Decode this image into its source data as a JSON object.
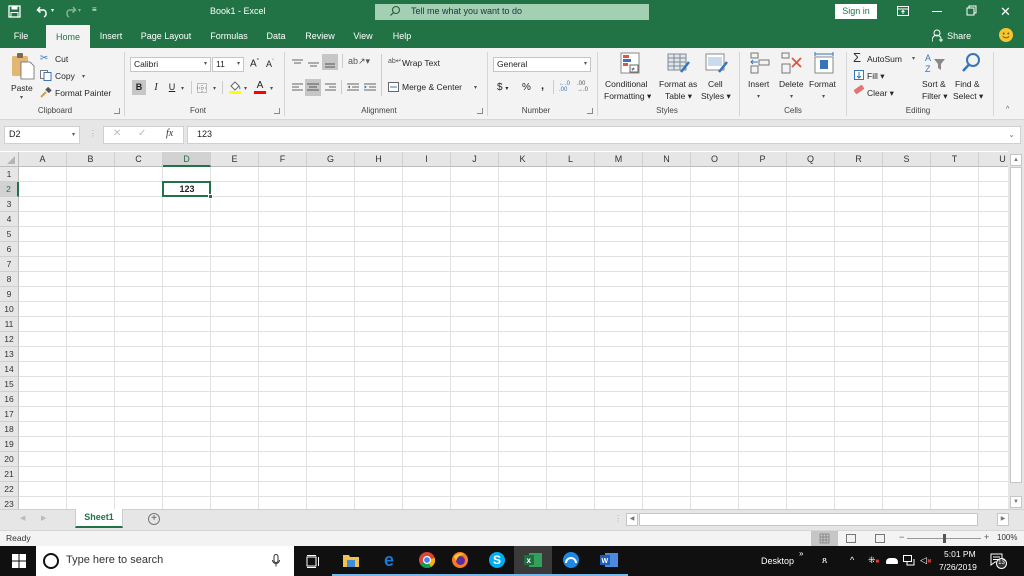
{
  "window": {
    "title": "Book1  -  Excel",
    "tell_me_placeholder": "Tell me what you want to do",
    "sign_in": "Sign in",
    "share": "Share"
  },
  "quick_access": {
    "save_icon": "save-icon",
    "undo_icon": "undo-icon",
    "redo_icon": "redo-icon",
    "customize_icon": "customize-icon"
  },
  "tabs": [
    {
      "label": "File"
    },
    {
      "label": "Home",
      "active": true
    },
    {
      "label": "Insert"
    },
    {
      "label": "Page Layout"
    },
    {
      "label": "Formulas"
    },
    {
      "label": "Data"
    },
    {
      "label": "Review"
    },
    {
      "label": "View"
    },
    {
      "label": "Help"
    }
  ],
  "ribbon": {
    "clipboard": {
      "label": "Clipboard",
      "paste": "Paste",
      "cut": "Cut",
      "copy": "Copy",
      "format_painter": "Format Painter"
    },
    "font": {
      "label": "Font",
      "font_name": "Calibri",
      "font_size": "11",
      "bold": "B",
      "italic": "I",
      "underline": "U",
      "grow": "A",
      "shrink": "A",
      "font_color": "A",
      "highlight_color": "#ffff00",
      "text_color": "#ff0000"
    },
    "alignment": {
      "label": "Alignment",
      "wrap_text": "Wrap Text",
      "merge_center": "Merge & Center"
    },
    "number": {
      "label": "Number",
      "format": "General",
      "currency": "$",
      "percent": "%",
      "comma": ",",
      "inc_decimal": "+.0 .00",
      "dec_decimal": ".00 →.0"
    },
    "styles": {
      "label": "Styles",
      "conditional_formatting": [
        "Conditional",
        "Formatting"
      ],
      "format_as_table": [
        "Format as",
        "Table"
      ],
      "cell_styles": [
        "Cell",
        "Styles"
      ]
    },
    "cells": {
      "label": "Cells",
      "insert": "Insert",
      "delete": "Delete",
      "format": "Format"
    },
    "editing": {
      "label": "Editing",
      "autosum": "AutoSum",
      "fill": "Fill",
      "clear": "Clear",
      "sort_filter": [
        "Sort &",
        "Filter"
      ],
      "find_select": [
        "Find &",
        "Select"
      ]
    }
  },
  "formula_bar": {
    "name_box": "D2",
    "fx": "fx",
    "value": "123"
  },
  "sheet": {
    "columns": [
      "A",
      "B",
      "C",
      "D",
      "E",
      "F",
      "G",
      "H",
      "I",
      "J",
      "K",
      "L",
      "M",
      "N",
      "O",
      "P",
      "Q",
      "R",
      "S",
      "T",
      "U"
    ],
    "rows": [
      "1",
      "2",
      "3",
      "4",
      "5",
      "6",
      "7",
      "8",
      "9",
      "10",
      "11",
      "12",
      "13",
      "14",
      "15",
      "16",
      "17",
      "18",
      "19",
      "20",
      "21",
      "22",
      "23"
    ],
    "selected_cell": "D2",
    "cells": [
      {
        "ref": "D2",
        "col": "D",
        "row": "2",
        "value": "123",
        "bold": true
      }
    ],
    "tabs": [
      {
        "label": "Sheet1",
        "active": true
      }
    ]
  },
  "status": {
    "mode": "Ready",
    "zoom": "100%",
    "zoom_level": 1.0
  },
  "taskbar": {
    "search_placeholder": "Type here to search",
    "desktop_label": "Desktop",
    "time": "5:01 PM",
    "date": "7/26/2019",
    "notifications": "13",
    "apps": [
      {
        "name": "task-view",
        "running": false
      },
      {
        "name": "file-explorer",
        "running": true
      },
      {
        "name": "edge",
        "running": true
      },
      {
        "name": "chrome",
        "running": true
      },
      {
        "name": "firefox",
        "running": true
      },
      {
        "name": "skype",
        "running": true
      },
      {
        "name": "excel",
        "running": true,
        "active": true
      },
      {
        "name": "app-blue",
        "running": true
      },
      {
        "name": "word",
        "running": true
      }
    ]
  },
  "colors": {
    "excel_green": "#217346",
    "ribbon_bg": "#f3f3f3",
    "taskbar_bg": "#101010"
  }
}
